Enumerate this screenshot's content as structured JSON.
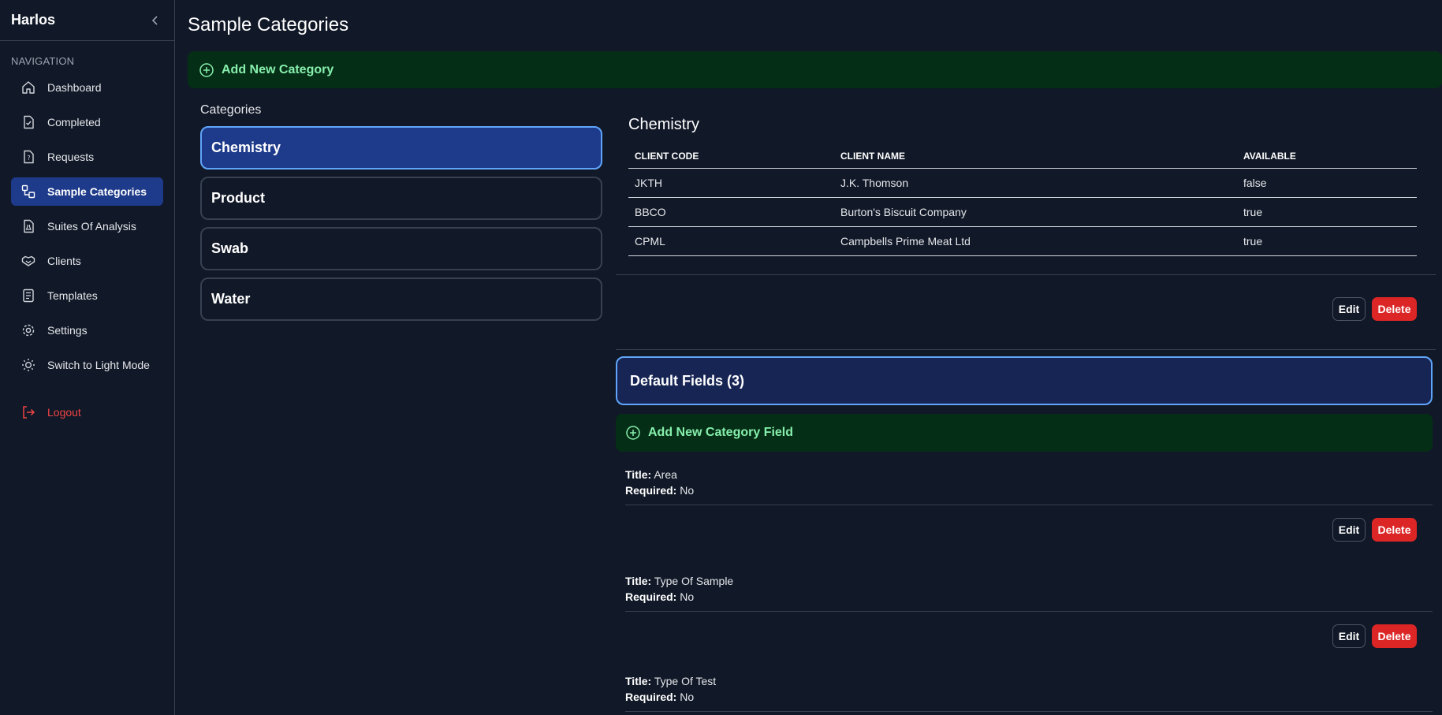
{
  "sidebar": {
    "title": "Harlos",
    "section": "NAVIGATION",
    "items": [
      {
        "label": "Dashboard",
        "icon": "home-icon"
      },
      {
        "label": "Completed",
        "icon": "file-check-icon"
      },
      {
        "label": "Requests",
        "icon": "question-icon"
      },
      {
        "label": "Sample Categories",
        "icon": "categories-icon",
        "active": true
      },
      {
        "label": "Suites Of Analysis",
        "icon": "flask-file-icon"
      },
      {
        "label": "Clients",
        "icon": "handshake-icon"
      },
      {
        "label": "Templates",
        "icon": "template-icon"
      },
      {
        "label": "Settings",
        "icon": "gear-icon"
      },
      {
        "label": "Switch to Light Mode",
        "icon": "sun-icon"
      }
    ],
    "logout": "Logout"
  },
  "main": {
    "title": "Sample Categories",
    "add_category": "Add New Category",
    "categories_heading": "Categories",
    "categories": [
      "Chemistry",
      "Product",
      "Swab",
      "Water"
    ],
    "selected": {
      "name": "Chemistry",
      "table": {
        "headers": [
          "CLIENT CODE",
          "CLIENT NAME",
          "AVAILABLE"
        ],
        "rows": [
          [
            "JKTH",
            "J.K. Thomson",
            "false"
          ],
          [
            "BBCO",
            "Burton's Biscuit Company",
            "true"
          ],
          [
            "CPML",
            "Campbells Prime Meat Ltd",
            "true"
          ]
        ]
      },
      "edit_label": "Edit",
      "delete_label": "Delete",
      "default_fields_label": "Default Fields (3)",
      "add_field": "Add New Category Field",
      "title_label": "Title:",
      "required_label": "Required:",
      "fields": [
        {
          "title": "Area",
          "required": "No"
        },
        {
          "title": "Type Of Sample",
          "required": "No"
        },
        {
          "title": "Type Of Test",
          "required": "No"
        }
      ]
    }
  },
  "colors": {
    "background": "#111827",
    "active_nav": "#1e3a8a",
    "add_bar_bg": "#052e16",
    "add_bar_text": "#86efac",
    "delete": "#dc2626",
    "logout": "#ef4444"
  }
}
